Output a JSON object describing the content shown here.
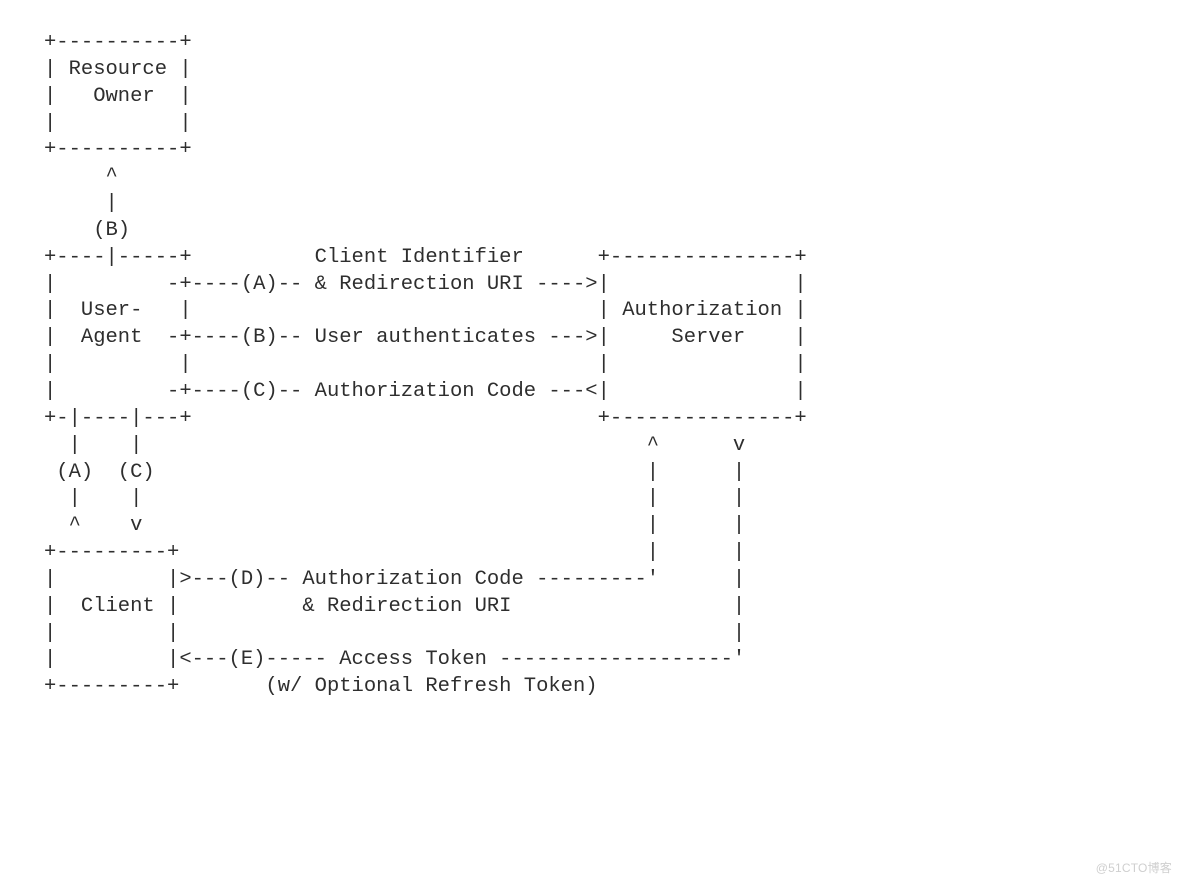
{
  "diagram": {
    "lines": [
      "+----------+",
      "| Resource |",
      "|   Owner  |",
      "|          |",
      "+----------+",
      "     ^",
      "     |",
      "    (B)",
      "+----|-----+          Client Identifier      +---------------+",
      "|         -+----(A)-- & Redirection URI ---->|               |",
      "|  User-   |                                 | Authorization |",
      "|  Agent  -+----(B)-- User authenticates --->|     Server    |",
      "|          |                                 |               |",
      "|         -+----(C)-- Authorization Code ---<|               |",
      "+-|----|---+                                 +---------------+",
      "  |    |                                         ^      v",
      " (A)  (C)                                        |      |",
      "  |    |                                         |      |",
      "  ^    v                                         |      |",
      "+---------+                                      |      |",
      "|         |>---(D)-- Authorization Code ---------'      |",
      "|  Client |          & Redirection URI                  |",
      "|         |                                             |",
      "|         |<---(E)----- Access Token -------------------'",
      "+---------+       (w/ Optional Refresh Token)"
    ],
    "entities": {
      "resource_owner": "Resource Owner",
      "user_agent": "User-Agent",
      "authorization_server": "Authorization Server",
      "client": "Client"
    },
    "flows": {
      "A_ua_to_as": "Client Identifier & Redirection URI",
      "B_ua_to_as": "User authenticates",
      "C_as_to_ua": "Authorization Code",
      "D_client_to_as": "Authorization Code & Redirection URI",
      "E_as_to_client": "Access Token (w/ Optional Refresh Token)",
      "B_ua_to_owner": "(B)",
      "A_client_to_ua": "(A)",
      "C_ua_to_client": "(C)"
    }
  },
  "watermark": "@51CTO博客"
}
